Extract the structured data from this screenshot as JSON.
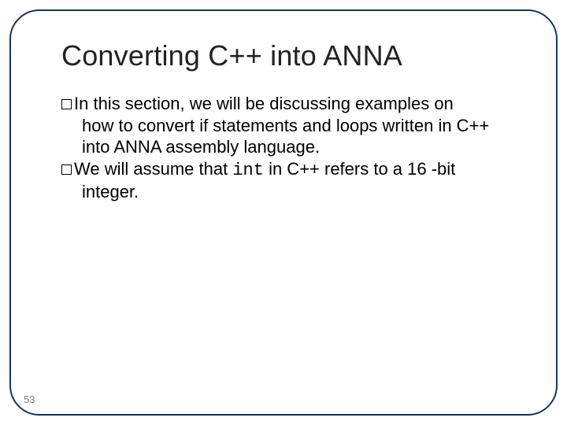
{
  "title": "Converting C++ into ANNA",
  "bullets": [
    {
      "first": "In this section, we will be discussing examples on",
      "rest": "how to convert if statements and loops written in C++ into ANNA assembly language."
    },
    {
      "first_pre": "We will assume that ",
      "code": "int",
      "first_post": " in C++ refers to a 16 -bit",
      "rest": "integer."
    }
  ],
  "page": "53"
}
